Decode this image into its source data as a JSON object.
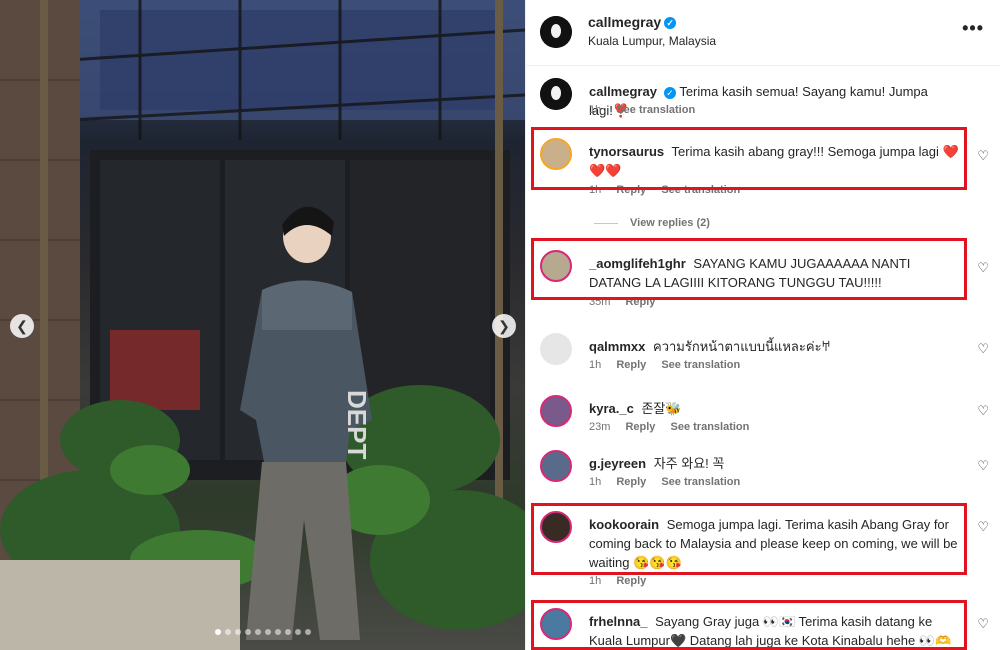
{
  "post": {
    "username": "callmegray",
    "location": "Kuala Lumpur, Malaysia",
    "carousel": {
      "total_slides": 10,
      "active_slide": 1
    }
  },
  "caption": {
    "username": "callmegray",
    "text": "Terima kasih semua! Sayang kamu! Jumpa lagi!❣️",
    "time": "1h",
    "translate": "See translation"
  },
  "comments": [
    {
      "username": "tynorsaurus",
      "text": "Terima kasih abang gray!!! Semoga jumpa lagi ❤️❤️❤️",
      "time": "1h",
      "reply": "Reply",
      "translate": "See translation",
      "view_replies": "View replies (2)",
      "highlighted": true
    },
    {
      "username": "_aomglifeh1ghr",
      "text": "SAYANG KAMU JUGAAAAAA NANTI DATANG LA LAGIIII KITORANG TUNGGU TAU!!!!!",
      "time": "35m",
      "reply": "Reply",
      "highlighted": true
    },
    {
      "username": "qalmmxx",
      "text": "ความรักหน้าตาแบบนี้แหละค่ะ𐀀",
      "time": "1h",
      "reply": "Reply",
      "translate": "See translation",
      "highlighted": false
    },
    {
      "username": "kyra._c",
      "text": "존잘🐝",
      "time": "23m",
      "reply": "Reply",
      "translate": "See translation",
      "highlighted": false
    },
    {
      "username": "g.jeyreen",
      "text": "자주 와요! 꼭",
      "time": "1h",
      "reply": "Reply",
      "translate": "See translation",
      "highlighted": false
    },
    {
      "username": "kookoorain",
      "text": "Semoga jumpa lagi. Terima kasih Abang Gray for coming back to Malaysia and please keep on coming, we will be waiting 😘😘😘",
      "time": "1h",
      "reply": "Reply",
      "highlighted": true
    },
    {
      "username": "frhelnna_",
      "text": "Sayang Gray juga 👀🇰🇷 Terima kasih datang ke Kuala Lumpur🖤 Datang lah juga ke Kota Kinabalu hehe 👀🫶",
      "highlighted": true
    }
  ],
  "colors": {
    "highlight": "#e0141e",
    "verified": "#0095f6",
    "meta": "#737373"
  },
  "icons": {
    "options": "more-options-icon",
    "like": "heart-icon",
    "verified": "verified-badge-icon",
    "prev": "chevron-left-icon",
    "next": "chevron-right-icon"
  }
}
